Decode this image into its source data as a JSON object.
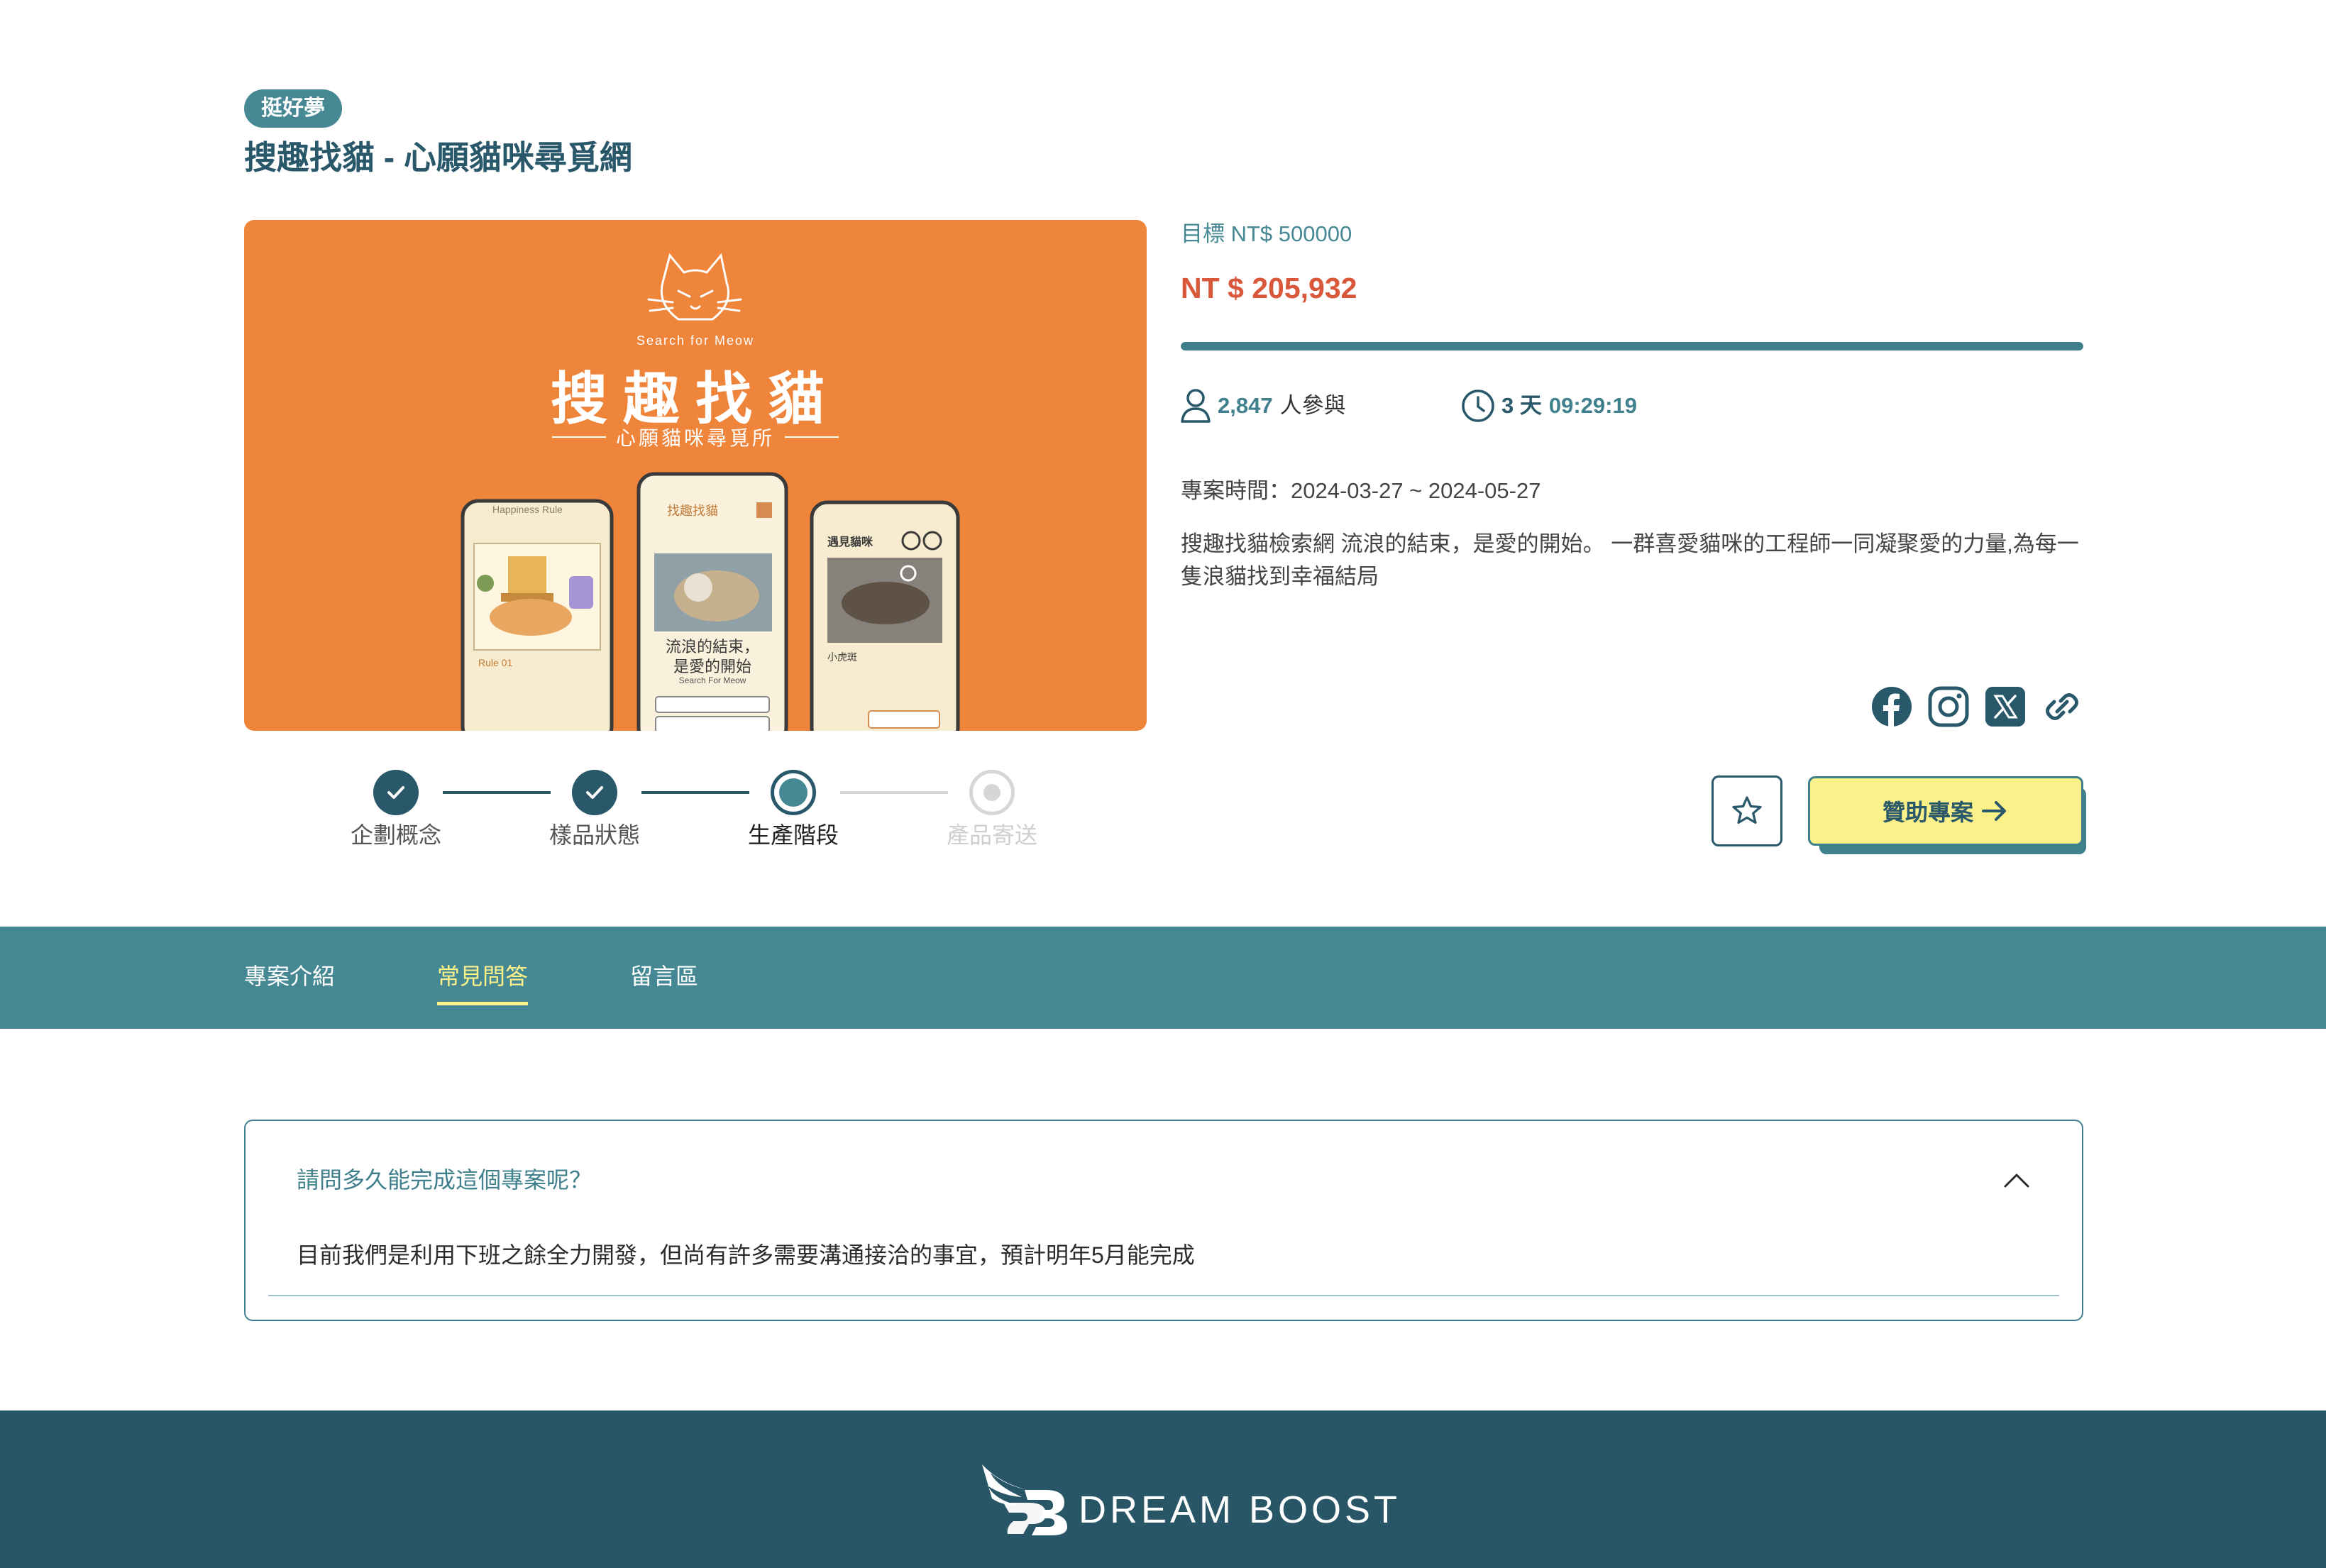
{
  "project": {
    "tag": "挺好夢",
    "title": "搜趣找貓 - 心願貓咪尋覓網"
  },
  "cover": {
    "subtitle_en": "Search for Meow",
    "title": "搜趣找貓",
    "subtitle": "心願貓咪尋覓所",
    "phone_left_header": "Happiness Rule",
    "phone_left_rule": "Rule 01",
    "phone_middle_brand": "找趣找貓",
    "phone_middle_line1": "流浪的結束，",
    "phone_middle_line2": "是愛的開始",
    "phone_middle_en": "Search For Meow",
    "phone_right_header": "遇見貓咪",
    "phone_right_name": "小虎斑"
  },
  "funding": {
    "goal_label": "目標 NT$ 500000",
    "raised": "NT $ 205,932",
    "progress_percent": 100,
    "participants": "2,847",
    "participants_suffix": "人參與",
    "days": "3 天",
    "time_left": "09:29:19",
    "period": "專案時間：2024-03-27 ~ 2024-05-27",
    "description": "搜趣找貓檢索網 流浪的結束，是愛的開始。 一群喜愛貓咪的工程師一同凝聚愛的力量,為每一隻浪貓找到幸福結局"
  },
  "social": [
    "facebook-icon",
    "instagram-icon",
    "x-icon",
    "link-icon"
  ],
  "actions": {
    "sponsor_label": "贊助專案"
  },
  "stepper": {
    "steps": [
      {
        "label": "企劃概念",
        "state": "done"
      },
      {
        "label": "樣品狀態",
        "state": "done"
      },
      {
        "label": "生產階段",
        "state": "current"
      },
      {
        "label": "產品寄送",
        "state": "pending"
      }
    ]
  },
  "tabs": [
    {
      "label": "專案介紹",
      "active": false
    },
    {
      "label": "常見問答",
      "active": true
    },
    {
      "label": "留言區",
      "active": false
    }
  ],
  "faq": {
    "question": "請問多久能完成這個專案呢？",
    "answer": "目前我們是利用下班之餘全力開發，但尚有許多需要溝通接洽的事宜，預計明年5月能完成"
  },
  "footer": {
    "brand": "DREAM BOOST"
  },
  "colors": {
    "teal": "#458893",
    "dark_teal": "#29586b",
    "accent_yellow": "#fbf18a",
    "raised_red": "#d9573a",
    "cover_orange": "#ef843b",
    "footer": "#285666"
  }
}
